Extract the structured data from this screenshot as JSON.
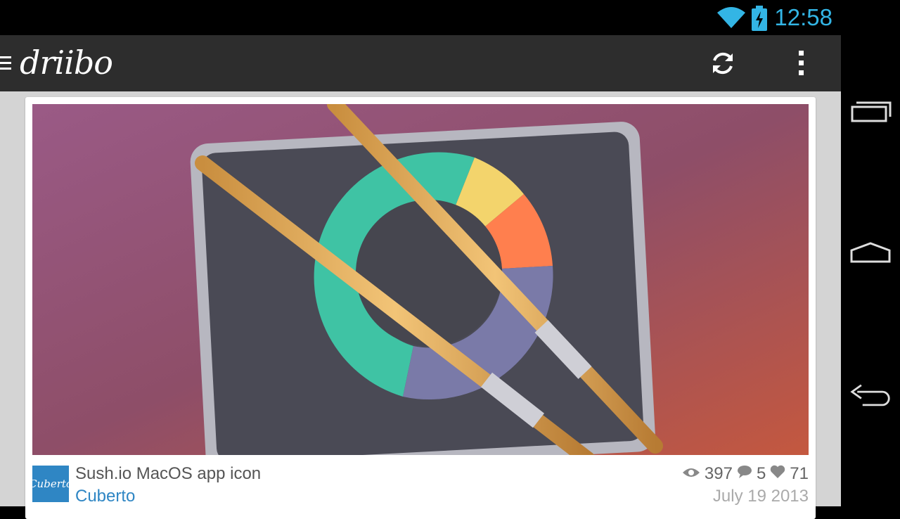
{
  "status_bar": {
    "time": "12:58",
    "accent_color": "#33b5e5",
    "icons": [
      "wifi-icon",
      "battery-charging-icon"
    ]
  },
  "app_bar": {
    "title": "driibo",
    "actions": [
      "refresh-icon",
      "overflow-menu-icon"
    ]
  },
  "shot": {
    "title": "Sush.io MacOS app icon",
    "author": "Cuberto",
    "avatar_text": "Cuberto",
    "views": "397",
    "comments": "5",
    "likes": "71",
    "date": "July 19 2013"
  },
  "nav_bar": {
    "buttons": [
      "recent-apps-icon",
      "home-icon",
      "back-icon"
    ]
  }
}
